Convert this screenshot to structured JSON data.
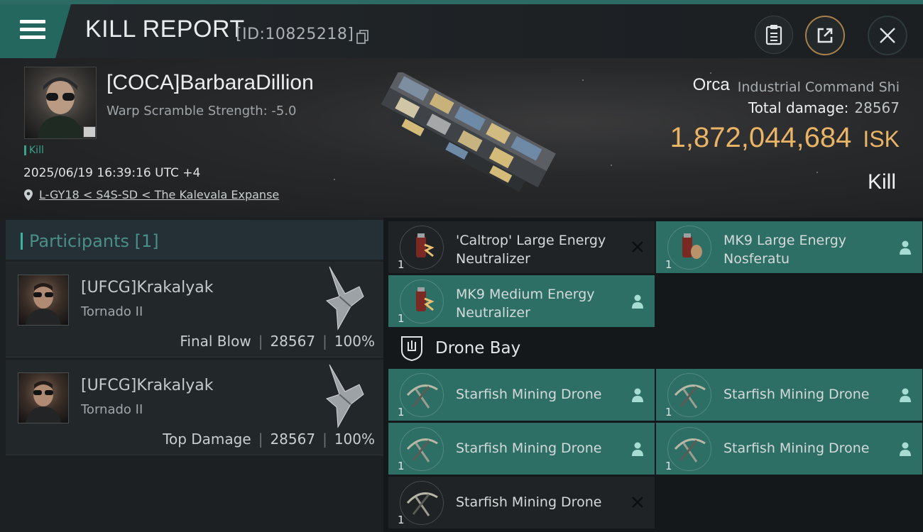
{
  "window": {
    "title": "KILL REPORT",
    "report_id": "[ID:10825218]"
  },
  "victim": {
    "name": "[COCA]BarbaraDillion",
    "warp_scramble": "Warp Scramble Strength: -5.0",
    "kill_tag": "Kill",
    "datetime": "2025/06/19 16:39:16 UTC +4",
    "location": "L-GY18 < S4S-SD < The Kalevala Expanse"
  },
  "ship": {
    "name": "Orca",
    "class": "Industrial Command Shi",
    "total_damage_label": "Total damage:",
    "total_damage": "28567",
    "isk_value": "1,872,044,684",
    "isk_unit": "ISK",
    "result": "Kill"
  },
  "participants": {
    "header": "Participants [1]",
    "rows": [
      {
        "name": "[UFCG]Krakalyak",
        "ship": "Tornado II",
        "role": "Final Blow",
        "damage": "28567",
        "percent": "100%"
      },
      {
        "name": "[UFCG]Krakalyak",
        "ship": "Tornado II",
        "role": "Top Damage",
        "damage": "28567",
        "percent": "100%"
      }
    ]
  },
  "modules": [
    {
      "label": "'Caltrop' Large Energy Neutralizer",
      "qty": "1",
      "status": "destroyed"
    },
    {
      "label": "MK9 Large Energy Nosferatu",
      "qty": "1",
      "status": "dropped"
    },
    {
      "label": "MK9 Medium Energy Neutralizer",
      "qty": "1",
      "status": "dropped"
    }
  ],
  "drone_bay": {
    "title": "Drone Bay",
    "items": [
      {
        "label": "Starfish Mining Drone",
        "qty": "1",
        "status": "dropped"
      },
      {
        "label": "Starfish Mining Drone",
        "qty": "1",
        "status": "dropped"
      },
      {
        "label": "Starfish Mining Drone",
        "qty": "1",
        "status": "dropped"
      },
      {
        "label": "Starfish Mining Drone",
        "qty": "1",
        "status": "dropped"
      },
      {
        "label": "Starfish Mining Drone",
        "qty": "1",
        "status": "destroyed"
      }
    ]
  },
  "colors": {
    "accent_teal": "#2d6f65",
    "isk_gold": "#e9b466",
    "kill_green": "#39a18c"
  },
  "icons": {
    "menu": "hamburger-icon",
    "copy": "copy-icon",
    "clipboard": "clipboard-icon",
    "share": "external-link-icon",
    "close": "close-icon",
    "location": "map-pin-icon",
    "dropped": "person-icon",
    "destroyed": "x-icon",
    "drone_bay": "drone-bay-icon"
  }
}
